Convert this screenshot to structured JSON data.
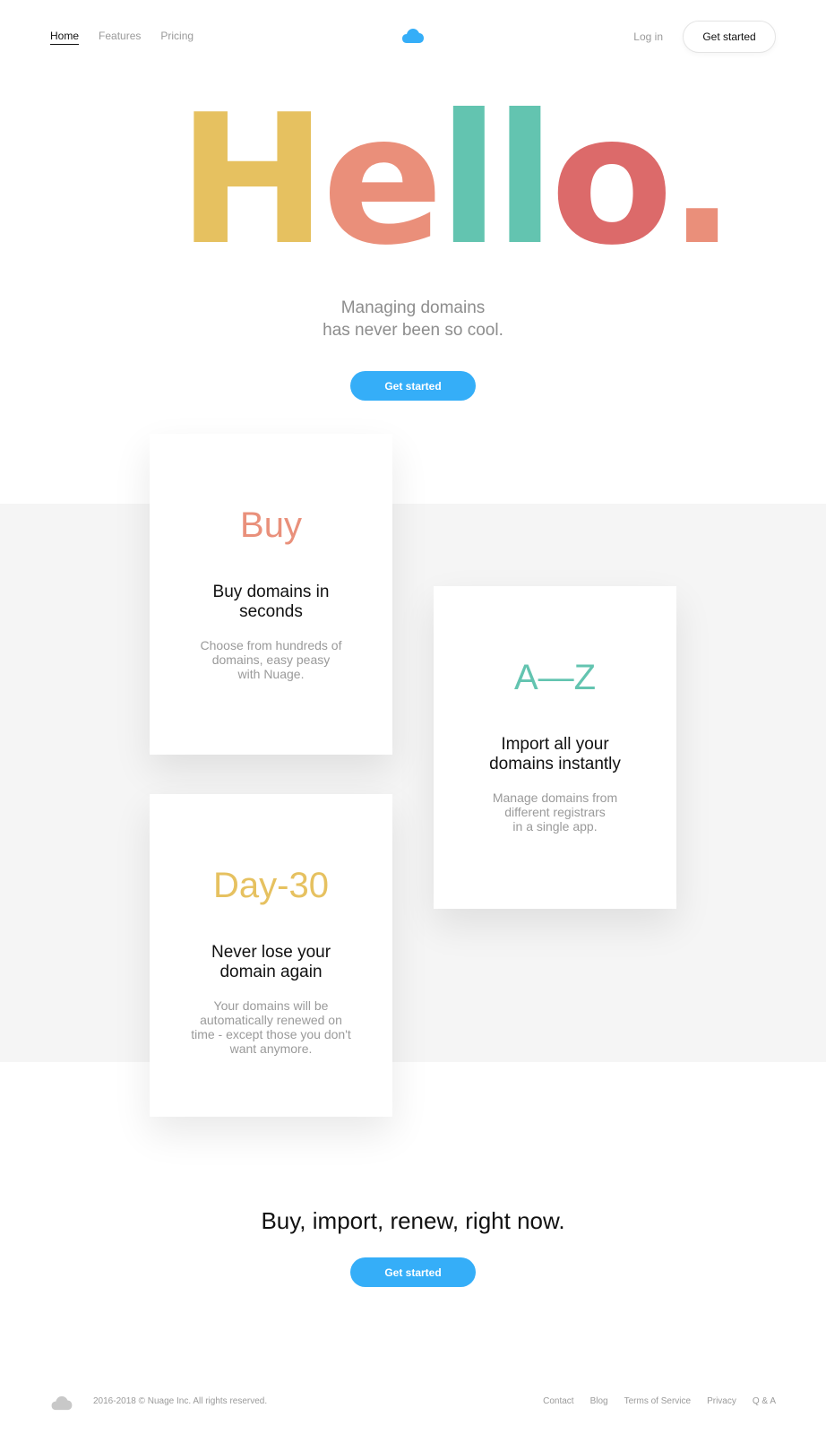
{
  "nav": {
    "links": [
      {
        "label": "Home",
        "active": true
      },
      {
        "label": "Features",
        "active": false
      },
      {
        "label": "Pricing",
        "active": false
      }
    ],
    "logo_icon": "cloud-icon",
    "login_label": "Log in",
    "cta_label": "Get started"
  },
  "hero": {
    "letters": [
      "H",
      "e",
      "l",
      "l",
      "o",
      "."
    ],
    "letter_colors": [
      "#e6c160",
      "#ea8f7a",
      "#63c4b0",
      "#63c4b0",
      "#dc6a6a",
      "#ea8f7a"
    ],
    "subtitle_line1": "Managing domains",
    "subtitle_line2": "has never been so cool.",
    "cta_label": "Get started"
  },
  "cards": [
    {
      "big": "Buy",
      "color": "#e9907b",
      "title_line1": "Buy domains in",
      "title_line2": "seconds",
      "text_lines": [
        "Choose from hundreds of",
        "domains, easy peasy",
        "with Nuage."
      ]
    },
    {
      "big": "A—Z",
      "color": "#63c4b0",
      "title_line1": "Import all your",
      "title_line2": "domains instantly",
      "text_lines": [
        "Manage domains from",
        "different registrars",
        "in a single app."
      ]
    },
    {
      "big": "Day-30",
      "color": "#e6c160",
      "title_line1": "Never lose your",
      "title_line2": "domain again",
      "text_lines": [
        "Your domains will be",
        "automatically renewed on",
        "time - except those you don't",
        "want anymore."
      ]
    }
  ],
  "cta": {
    "title": "Buy, import, renew, right now.",
    "button_label": "Get started"
  },
  "footer": {
    "logo_icon": "cloud-icon",
    "copyright": "2016-2018 © Nuage Inc. All rights reserved.",
    "links": [
      "Contact",
      "Blog",
      "Terms of Service",
      "Privacy",
      "Q & A"
    ]
  },
  "colors": {
    "accent": "#35aef8",
    "band": "#f5f5f5",
    "muted": "#9a9a9a"
  }
}
